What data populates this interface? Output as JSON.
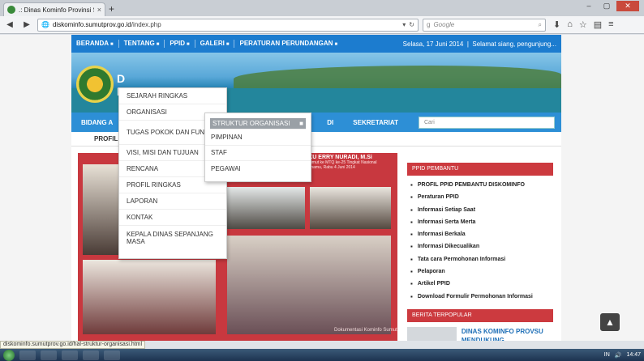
{
  "browser": {
    "tab_title": ".: Dinas Kominfo Provinsi Su...",
    "url_domain": "diskominfo.sumutprov.go.id",
    "url_path": "/index.php",
    "search_placeholder": "Google",
    "status_url": "diskominfo.sumutprov.go.id/hal-struktur-organisasi.html"
  },
  "topmenu": {
    "items": [
      "BERANDA",
      "TENTANG",
      "PPID",
      "GALERI",
      "PERATURAN PERUNDANGAN"
    ],
    "date": "Selasa, 17 Juni 2014",
    "greeting": "Selamat siang, pengunjung..."
  },
  "banner": {
    "text1": "D",
    "text2": "P"
  },
  "mainmenu": {
    "first": "BIDANG A",
    "item_di": "DI",
    "sekretariat": "SEKRETARIAT",
    "search_placeholder": "Cari"
  },
  "subtab": "PROFIL",
  "dropdown_tentang": [
    "SEJARAH RINGKAS",
    "ORGANISASI",
    "TUGAS POKOK DAN FUNGSI",
    "VISI, MISI DAN TUJUAN",
    "RENCANA",
    "PROFIL RINGKAS",
    "LAPORAN",
    "KONTAK",
    "KEPALA DINAS SEPANJANG MASA"
  ],
  "dropdown_organisasi": [
    "STRUKTUR ORGANISASI",
    "PIMPINAN",
    "STAF",
    "PEGAWAI"
  ],
  "photo": {
    "caption_title": "WAGUBSU Ir. H. TENGKU ERRY NURADI, M.Si",
    "caption_line1": "Melepas Keberangkatan 45 Kafilah Sumut ke MTQ ke-25 Tingkat Nasional",
    "caption_line2": "VIP Room Bandara Kualanamu, Rabu 4 Juni 2014",
    "watermark": "Dokumentasi Kominfo Sumut"
  },
  "sidebar": {
    "ppid_title": "PPID PEMBANTU",
    "ppid_items": [
      "PROFIL PPID PEMBANTU DISKOMINFO",
      "Peraturan PPID",
      "Informasi Setiap Saat",
      "Informasi Serta Merta",
      "Informasi Berkala",
      "Informasi Dikecualikan",
      "Tata cara Permohonan Informasi",
      "Pelaporan",
      "Artikel PPID",
      "Download Formulir Permohonan Informasi"
    ],
    "berita_title": "BERITA TERPOPULAR",
    "news_title": "DINAS KOMINFO PROVSU MENDUKUNG"
  },
  "taskbar": {
    "lang": "IN",
    "time": "14:47"
  }
}
